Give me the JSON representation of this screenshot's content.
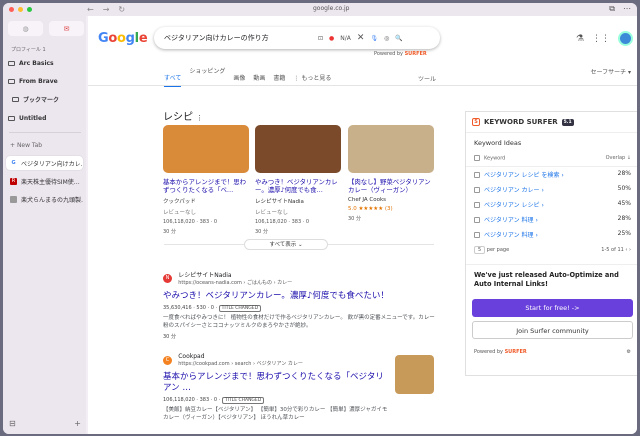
{
  "browser": {
    "url": "google.co.jp"
  },
  "sidebar": {
    "profile": "プロフィール 1",
    "folders": [
      {
        "label": "Arc Basics"
      },
      {
        "label": "From Brave"
      },
      {
        "label": "ブックマーク"
      },
      {
        "label": "Untitled"
      }
    ],
    "new_tab": "New Tab",
    "tabs": [
      {
        "label": "ベジタリアン向けカレ…",
        "active": true
      },
      {
        "label": "楽天株主優待SIM使…",
        "active": false
      },
      {
        "label": "楽犬らんまるの九頭製…",
        "active": false
      }
    ]
  },
  "search": {
    "query": "ベジタリアン向けカレーの作り方",
    "na_label": "N/A",
    "powered_by": "Powered by",
    "powered_brand": "SURFER"
  },
  "tabs": [
    {
      "label": "すべて",
      "active": true
    },
    {
      "label": "ショッピング"
    },
    {
      "label": "画像"
    },
    {
      "label": "動画"
    },
    {
      "label": "書籍"
    },
    {
      "label": "⋮ もっと見る"
    }
  ],
  "tools_label": "ツール",
  "safesearch_label": "セーフサーチ ▾",
  "recipes": {
    "heading": "レシピ",
    "cards": [
      {
        "title": "基本からアレンジまで！思わずつくりたくなる「ベ…",
        "source": "クックパッド",
        "reviews": "レビューなし",
        "meta": "106,118,020 · 383 · 0",
        "color": "#d98b3a"
      },
      {
        "title": "やみつき！ベジタリアンカレー。濃厚♪何度でも食…",
        "source": "レシピサイトNadia",
        "reviews": "レビューなし",
        "meta": "106,118,020 · 383 · 0",
        "color": "#7a4a2a"
      },
      {
        "title": "【肉なし】野菜ベジタリアンカレー（ヴィーガン）",
        "source": "Chef JA Cooks",
        "reviews": "5.0 ★★★★★ (3)",
        "meta": "30 分",
        "color": "#c7b08a"
      }
    ],
    "card_time_1": "30 分",
    "card_time_2": "30 分",
    "show_all": "すべて表示 ⌄"
  },
  "results": [
    {
      "site": "レシピサイトNadia",
      "url": "https://oceans-nadia.com › ごはんもの › カレー",
      "title": "やみつき！ベジタリアンカレー。濃厚♪何度でも食べたい！",
      "stats": "35,630,416 · 530 · 0",
      "badge": "TITLE CHANGED",
      "snippet": "一度食べればやみつきに！ 植物性の食材だけで作るベジタリアンカレー。 飲が黒の定番メニューです。カレー粉のスパイシーさとココナッツミルクのまろやかさが絶妙。",
      "time": "30 分"
    },
    {
      "site": "Cookpad",
      "url": "https://cookpad.com › search › ベジタリアン カレー",
      "title": "基本からアレンジまで！思わずつくりたくなる「ベジタリアン …",
      "stats": "106,118,020 · 383 · 0",
      "badge": "TITLE CHANGED",
      "snippet": "【美飯】納豆カレー【ベジタリアン】 【簡単】30分で彩りカレー 【簡単】濃厚ジャガイモカレー（ヴィーガン）【ベジタリアン】 ほうれん草カレー"
    }
  ],
  "keyword_surfer": {
    "title": "KEYWORD SURFER",
    "version": "5.1",
    "section": "Keyword Ideas",
    "col_keyword": "Keyword",
    "col_overlap": "Overlap",
    "rows": [
      {
        "keyword": "ベジタリアン レシピ を検索 ›",
        "overlap": "28%"
      },
      {
        "keyword": "ベジタリアン カレー ›",
        "overlap": "50%"
      },
      {
        "keyword": "ベジタリアン レシピ ›",
        "overlap": "45%"
      },
      {
        "keyword": "ベジタリアン 料理 ›",
        "overlap": "28%"
      },
      {
        "keyword": "ベジタリアン 料理 ›",
        "overlap": "25%"
      }
    ],
    "per_page_value": "5",
    "per_page_label": "per page",
    "pagination": "1-5 of 11",
    "promo": "We've just released Auto-Optimize and Auto Internal Links!",
    "cta_primary": "Start for free! ->",
    "cta_secondary": "Join Surfer community",
    "footer_powered": "Powered by",
    "footer_brand": "SURFER"
  },
  "colors": {
    "accent": "#1a73e8",
    "link": "#1a0dab",
    "surfer_brand": "#f05a28",
    "cta": "#6a40dc"
  }
}
